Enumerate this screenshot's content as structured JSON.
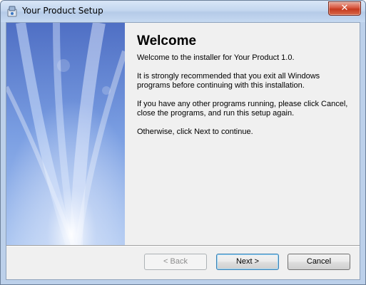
{
  "window": {
    "title": "Your Product Setup",
    "close_label": "✕"
  },
  "content": {
    "heading": "Welcome",
    "paragraphs": [
      "Welcome to the installer for Your Product 1.0.",
      "It is strongly recommended that you exit all Windows programs before continuing with this installation.",
      "If you have any other programs running, please click Cancel, close the programs, and run this setup again.",
      "Otherwise, click Next to continue."
    ]
  },
  "buttons": {
    "back": "< Back",
    "next": "Next >",
    "cancel": "Cancel"
  },
  "colors": {
    "panel_blue": "#6f93d6",
    "background": "#f0f0f0"
  },
  "icons": {
    "app": "installer-icon",
    "close": "close-icon"
  }
}
